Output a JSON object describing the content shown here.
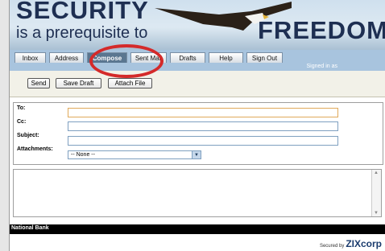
{
  "banner": {
    "line1": "SECURITY",
    "line2": "is a prerequisite to",
    "line3": "FREEDOM"
  },
  "tabs": [
    {
      "label": "Inbox"
    },
    {
      "label": "Address"
    },
    {
      "label": "Compose"
    },
    {
      "label": "Sent Mail"
    },
    {
      "label": "Drafts"
    },
    {
      "label": "Help"
    },
    {
      "label": "Sign Out"
    }
  ],
  "signed_in": "Signed in as",
  "toolbar": {
    "send": "Send",
    "save_draft": "Save Draft",
    "attach": "Attach File"
  },
  "form": {
    "to_label": "To:",
    "cc_label": "Cc:",
    "subject_label": "Subject:",
    "attachments_label": "Attachments:",
    "attachments_value": "-- None --"
  },
  "footer": {
    "bank": "National Bank",
    "secured_by": "Secured by",
    "brand": "ZIXcorp"
  },
  "colors": {
    "tabbar": "#a8c4de",
    "active_tab": "#5a7690",
    "highlight_circle": "#d42a2a"
  }
}
